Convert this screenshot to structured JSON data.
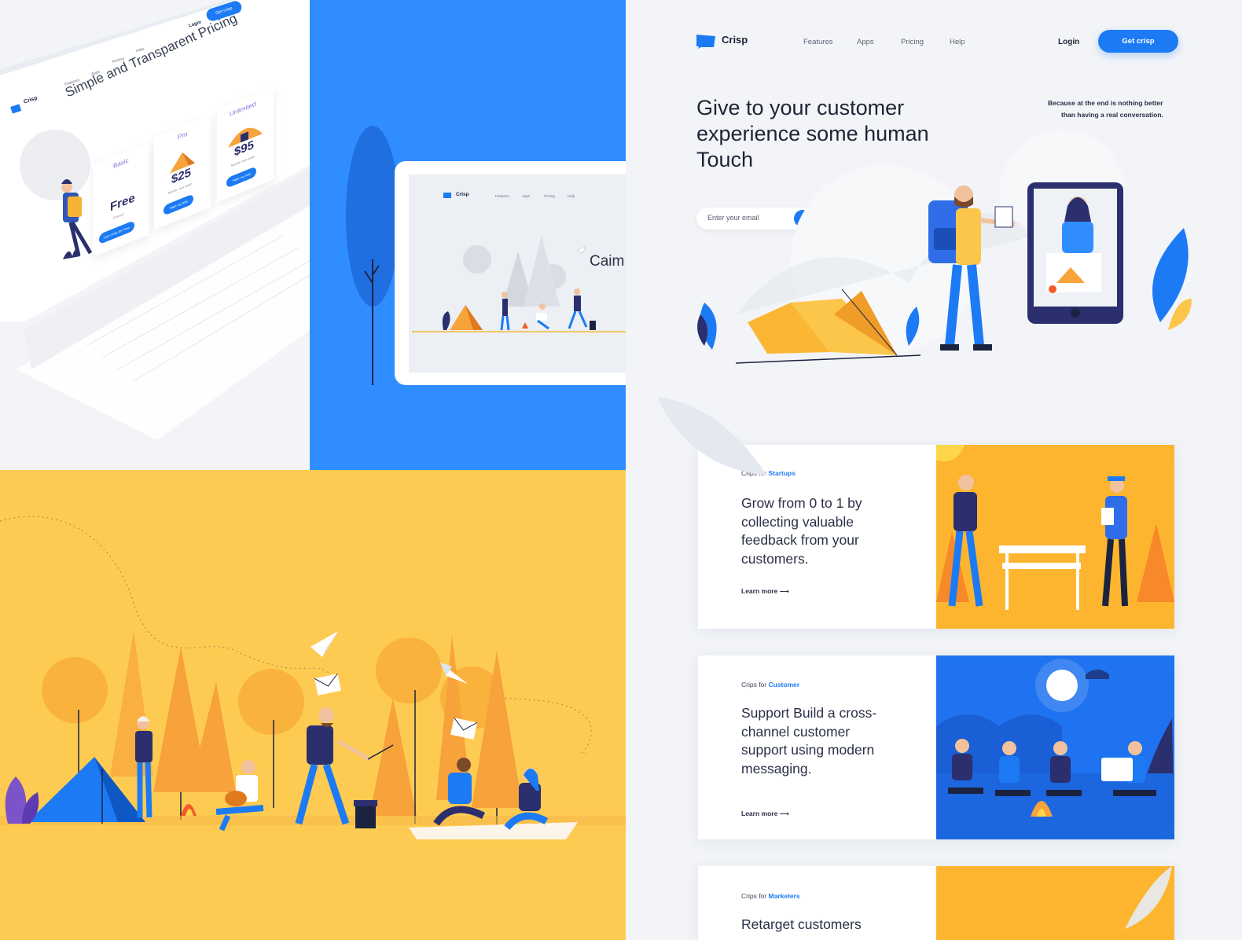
{
  "laptop": {
    "brand": "Crisp",
    "nav": [
      "Features",
      "Apps",
      "Pricing",
      "Help"
    ],
    "login": "Login",
    "cta": "Get crisp",
    "title": "Simple and Transparent Pricing",
    "plans": [
      {
        "name": "Basic",
        "price": "Free",
        "period": "Forever",
        "button": "Use Crisp for Free"
      },
      {
        "name": "Pro",
        "price": "$25",
        "period": "Month / per team",
        "button": "Start my trial"
      },
      {
        "name": "Unlimited",
        "price": "$95",
        "period": "Month / per team",
        "button": "Start my trial"
      }
    ]
  },
  "tablet": {
    "brand": "Crisp",
    "nav": [
      "Features",
      "Apps",
      "Pricing",
      "Help"
    ],
    "headline_fragment": "Caim"
  },
  "page": {
    "brand": "Crisp",
    "nav": {
      "features": "Features",
      "apps": "Apps",
      "pricing": "Pricing",
      "help": "Help"
    },
    "login": "Login",
    "cta": "Get crisp",
    "hero_title": "Give to your customer experience some human Touch",
    "hero_quote_line1": "Because at the end is nothing better",
    "hero_quote_line2": "than having a real conversation.",
    "email_placeholder": "Enter your email",
    "email_submit_icon": "arrow-right-icon",
    "cards": [
      {
        "eyebrow_prefix": "Crips for",
        "eyebrow_highlight": "Startups",
        "body": "Grow from 0 to 1 by collecting valuable feedback from your customers.",
        "link": "Learn more"
      },
      {
        "eyebrow_prefix": "Crips for",
        "eyebrow_highlight": "Customer",
        "body": "Support Build a cross-channel customer support using modern messaging.",
        "link": "Learn more"
      },
      {
        "eyebrow_prefix": "Crips for",
        "eyebrow_highlight": "Marketers",
        "body": "Retarget customers",
        "link": ""
      }
    ]
  },
  "colors": {
    "brand_blue": "#1c7bf4",
    "panel_blue": "#2f8dff",
    "yellow": "#fecb52",
    "orange": "#f7a23a",
    "navy": "#2b2f6e"
  }
}
